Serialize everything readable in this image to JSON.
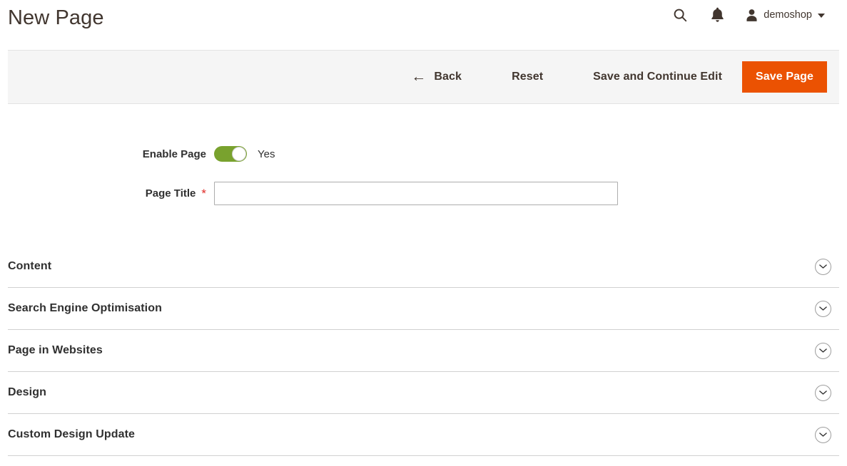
{
  "header": {
    "title": "New Page",
    "search_icon": "search-icon",
    "notifications_icon": "bell-icon",
    "user": {
      "avatar_icon": "user-avatar-icon",
      "name": "demoshop",
      "caret_icon": "chevron-down-icon"
    }
  },
  "toolbar": {
    "back_icon": "arrow-left-icon",
    "back_label": "Back",
    "reset_label": "Reset",
    "save_continue_label": "Save and Continue Edit",
    "save_label": "Save Page",
    "primary_color": "#eb5202"
  },
  "form": {
    "enable_page": {
      "label": "Enable Page",
      "value_text": "Yes",
      "toggle_on": true,
      "toggle_color": "#79a22e"
    },
    "page_title": {
      "label": "Page Title",
      "required_mark": "*",
      "value": "",
      "placeholder": ""
    }
  },
  "sections": [
    {
      "title": "Content",
      "icon": "chevron-down-icon"
    },
    {
      "title": "Search Engine Optimisation",
      "icon": "chevron-down-icon"
    },
    {
      "title": "Page in Websites",
      "icon": "chevron-down-icon"
    },
    {
      "title": "Design",
      "icon": "chevron-down-icon"
    },
    {
      "title": "Custom Design Update",
      "icon": "chevron-down-icon"
    }
  ]
}
